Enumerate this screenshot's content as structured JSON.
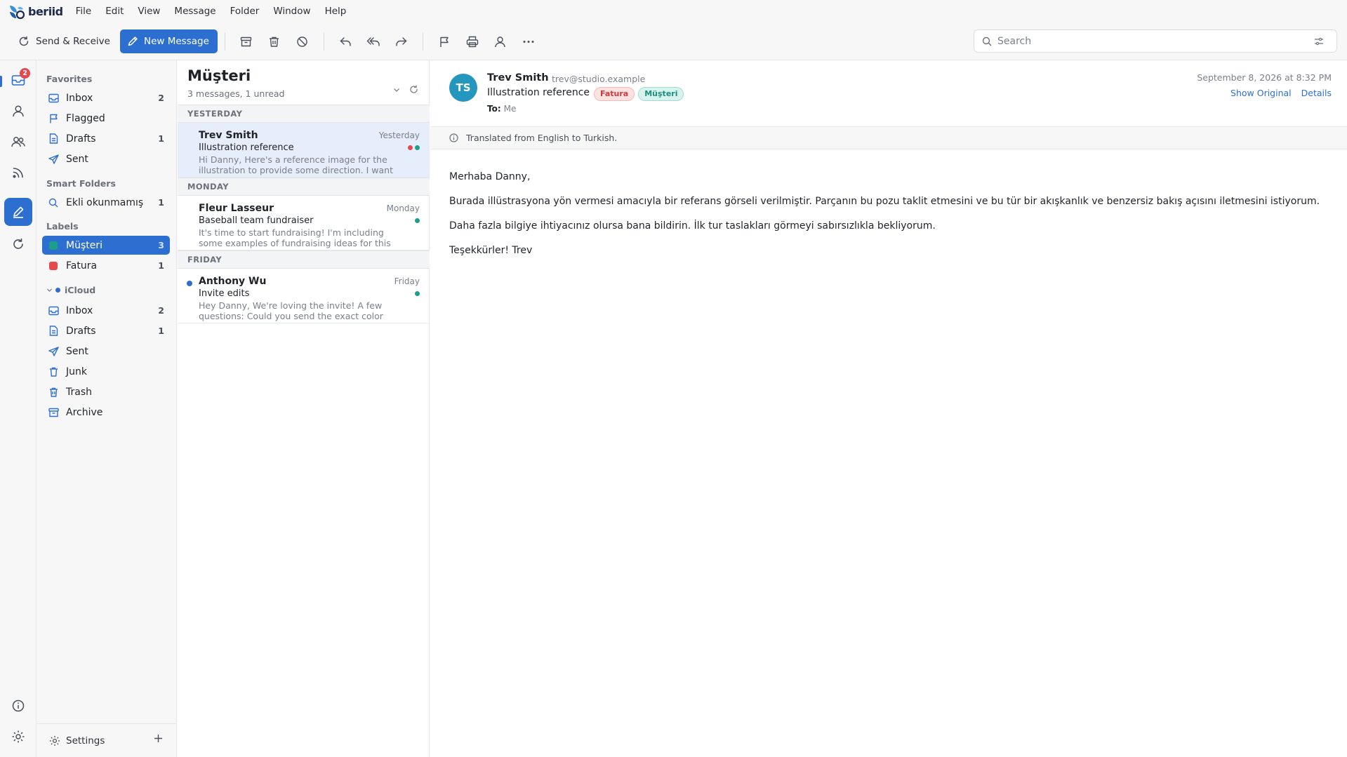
{
  "app": {
    "logo_text": "beriid"
  },
  "menu": [
    "File",
    "Edit",
    "View",
    "Message",
    "Folder",
    "Window",
    "Help"
  ],
  "toolbar": {
    "send_receive": "Send & Receive",
    "new_message": "New Message",
    "search_placeholder": "Search"
  },
  "rail": {
    "mail_badge": "2"
  },
  "sidebar": {
    "favorites_label": "Favorites",
    "favorites": [
      {
        "label": "Inbox",
        "count": "2"
      },
      {
        "label": "Flagged",
        "count": ""
      },
      {
        "label": "Drafts",
        "count": "1"
      },
      {
        "label": "Sent",
        "count": ""
      }
    ],
    "smart_label": "Smart Folders",
    "smart": [
      {
        "label": "Ekli okunmamış",
        "count": "1"
      }
    ],
    "labels_label": "Labels",
    "labels": [
      {
        "label": "Müşteri",
        "count": "3",
        "color": "#1b9e8a"
      },
      {
        "label": "Fatura",
        "count": "1",
        "color": "#e5484d"
      }
    ],
    "account_label": "iCloud",
    "account": [
      {
        "label": "Inbox",
        "count": "2"
      },
      {
        "label": "Drafts",
        "count": "1"
      },
      {
        "label": "Sent",
        "count": ""
      },
      {
        "label": "Junk",
        "count": ""
      },
      {
        "label": "Trash",
        "count": ""
      },
      {
        "label": "Archive",
        "count": ""
      }
    ],
    "settings": "Settings"
  },
  "list": {
    "title": "Müşteri",
    "subtitle": "3 messages, 1 unread",
    "groups": [
      "YESTERDAY",
      "MONDAY",
      "FRIDAY"
    ],
    "messages": [
      {
        "from": "Trev Smith",
        "date": "Yesterday",
        "subject": "Illustration reference",
        "preview": "Hi Danny, Here's a reference image for the illustration to provide some direction. I want the...",
        "tag_colors": [
          "#e5484d",
          "#1b9e8a"
        ]
      },
      {
        "from": "Fleur Lasseur",
        "date": "Monday",
        "subject": "Baseball team fundraiser",
        "preview": "It's time to start fundraising! I'm including some examples of fundraising ideas for this year. Let's...",
        "tag_colors": [
          "#1b9e8a"
        ]
      },
      {
        "from": "Anthony Wu",
        "date": "Friday",
        "subject": "Invite edits",
        "preview": "Hey Danny, We're loving the invite! A few questions: Could you send the exact color codes...",
        "tag_colors": [
          "#1b9e8a"
        ]
      }
    ]
  },
  "reader": {
    "initials": "TS",
    "from_name": "Trev Smith",
    "from_email": "trev@studio.example",
    "subject": "Illustration reference",
    "tags": [
      "Fatura",
      "Müşteri"
    ],
    "to_label": "To:",
    "to_value": "Me",
    "date": "September 8, 2026 at 8:32 PM",
    "show_original": "Show Original",
    "details": "Details",
    "translation_note": "Translated from English to Turkish.",
    "body": [
      "Merhaba Danny,",
      "Burada illüstrasyona yön vermesi amacıyla bir referans görseli verilmiştir. Parçanın bu pozu taklit etmesini ve bu tür bir akışkanlık ve benzersiz bakış açısını iletmesini istiyorum.",
      "Daha fazla bilgiye ihtiyacınız olursa bana bildirin. İlk tur taslakları görmeyi sabırsızlıkla bekliyorum.",
      "Teşekkürler! Trev"
    ]
  }
}
